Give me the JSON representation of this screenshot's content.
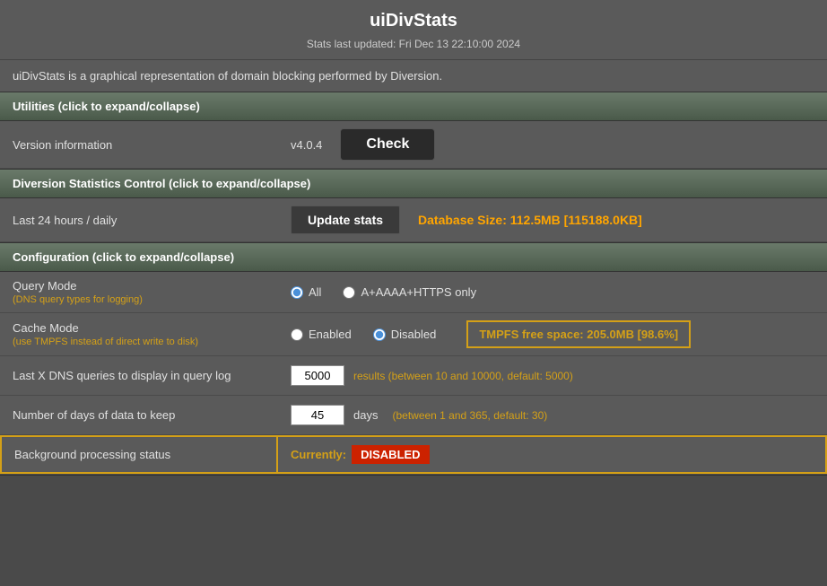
{
  "header": {
    "title": "uiDivStats",
    "subtitle": "Stats last updated: Fri Dec 13 22:10:00 2024"
  },
  "description": "uiDivStats is a graphical representation of domain blocking performed by Diversion.",
  "sections": {
    "utilities": {
      "label": "Utilities (click to expand/collapse)",
      "version_label": "Version information",
      "version_value": "v4.0.4",
      "check_button": "Check"
    },
    "diversion": {
      "label": "Diversion Statistics Control (click to expand/collapse)",
      "row_label": "Last 24 hours / daily",
      "update_button": "Update stats",
      "db_size": "Database Size: 112.5MB [115188.0KB]"
    },
    "configuration": {
      "label": "Configuration (click to expand/collapse)",
      "query_mode": {
        "label": "Query Mode",
        "sublabel": "(DNS query types for logging)",
        "option_all": "All",
        "option_https": "A+AAAA+HTTPS only"
      },
      "cache_mode": {
        "label": "Cache Mode",
        "sublabel": "(use TMPFS instead of direct write to disk)",
        "option_enabled": "Enabled",
        "option_disabled": "Disabled",
        "tmpfs_text": "TMPFS free space: 205.0MB [98.6%]"
      },
      "query_log": {
        "label": "Last X DNS queries to display in query log",
        "value": "5000",
        "hint": "results (between 10 and 10000, default: 5000)"
      },
      "days_keep": {
        "label": "Number of days of data to keep",
        "value": "45",
        "days_label": "days",
        "hint": "(between 1 and 365, default: 30)"
      },
      "bg_status": {
        "label": "Background processing status",
        "currently_label": "Currently:",
        "status_value": "DISABLED"
      }
    }
  }
}
